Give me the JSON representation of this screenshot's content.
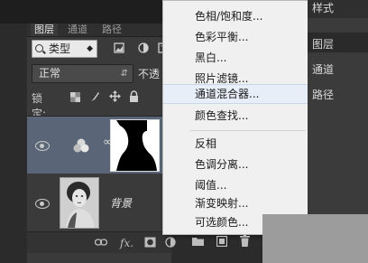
{
  "layers_panel": {
    "tabs": [
      "图层",
      "通道",
      "路径"
    ],
    "filter": {
      "label": "类型",
      "icon": "search-icon"
    },
    "blend_mode": "正常",
    "opacity_label": "不透",
    "lock_label": "锁定:",
    "layers": [
      {
        "name": "",
        "type": "channel-mixer-adjustment",
        "selected": true
      },
      {
        "name": "背景",
        "type": "image",
        "selected": false
      }
    ],
    "bottom_icons": [
      "link-icon",
      "fx-icon",
      "mask-icon",
      "adjustment-icon",
      "group-icon",
      "new-layer-icon",
      "trash-icon"
    ],
    "bottom_fx": "fx."
  },
  "menu": {
    "items": [
      {
        "label": "色相/饱和度..."
      },
      {
        "label": "色彩平衡..."
      },
      {
        "label": "黑白..."
      },
      {
        "label": "照片滤镜..."
      },
      {
        "label": "通道混合器...",
        "highlighted": true
      },
      {
        "label": "颜色查找..."
      },
      {
        "label": "反相"
      },
      {
        "label": "色调分离..."
      },
      {
        "label": "阈值..."
      },
      {
        "label": "渐变映射..."
      },
      {
        "label": "可选颜色..."
      }
    ]
  },
  "right_panel": {
    "top": "样式",
    "items": [
      "图层",
      "通道",
      "路径"
    ]
  }
}
